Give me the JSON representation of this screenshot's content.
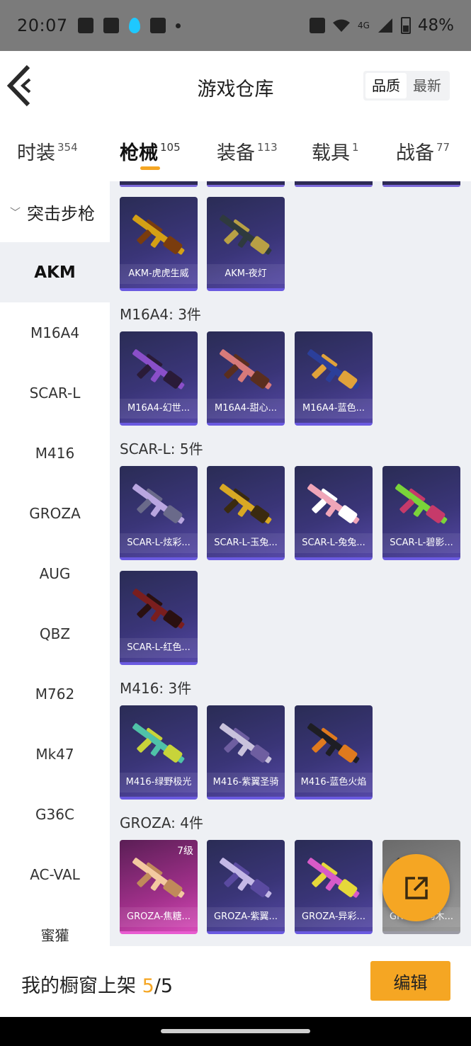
{
  "status_bar": {
    "time": "20:07",
    "network": "4G",
    "battery": "48%"
  },
  "header": {
    "title": "游戏仓库",
    "sort_options": [
      "品质",
      "最新"
    ],
    "sort_selected": "品质"
  },
  "tabs": [
    {
      "label": "时装",
      "count": "354"
    },
    {
      "label": "枪械",
      "count": "105",
      "active": true
    },
    {
      "label": "装备",
      "count": "113"
    },
    {
      "label": "载具",
      "count": "1"
    },
    {
      "label": "战备",
      "count": "77"
    }
  ],
  "sidebar": {
    "category": "突击步枪",
    "items": [
      "AKM",
      "M16A4",
      "SCAR-L",
      "M416",
      "GROZA",
      "AUG",
      "QBZ",
      "M762",
      "Mk47",
      "G36C",
      "AC-VAL",
      "蜜獾"
    ],
    "active": "AKM"
  },
  "sections": [
    {
      "title": "",
      "items": [
        {
          "name": "AKM-虎虎生威",
          "skin": [
            "#d4a015",
            "#7a3c0e"
          ]
        },
        {
          "name": "AKM-夜灯",
          "skin": [
            "#2f3a3e",
            "#b8a045"
          ]
        }
      ]
    },
    {
      "title": "M16A4: 3件",
      "items": [
        {
          "name": "M16A4-幻世...",
          "skin": [
            "#8a4fc9",
            "#2a1b38"
          ]
        },
        {
          "name": "M16A4-甜心...",
          "skin": [
            "#d77a7a",
            "#5a2e1e"
          ]
        },
        {
          "name": "M16A4-蓝色...",
          "skin": [
            "#2b3f9a",
            "#e0a23a"
          ]
        }
      ]
    },
    {
      "title": "SCAR-L: 5件",
      "items": [
        {
          "name": "SCAR-L-炫彩...",
          "skin": [
            "#b9a6e0",
            "#6a6a8a"
          ]
        },
        {
          "name": "SCAR-L-玉兔...",
          "skin": [
            "#d8a824",
            "#3a2a10"
          ]
        },
        {
          "name": "SCAR-L-兔兔...",
          "skin": [
            "#f0a5b8",
            "#ffffff"
          ]
        },
        {
          "name": "SCAR-L-碧影...",
          "skin": [
            "#7ad43a",
            "#c63a6a"
          ]
        },
        {
          "name": "SCAR-L-红色...",
          "skin": [
            "#7a1e1e",
            "#2a1010"
          ]
        }
      ]
    },
    {
      "title": "M416: 3件",
      "items": [
        {
          "name": "M416-绿野极光",
          "skin": [
            "#4fc2a8",
            "#c8d43a"
          ]
        },
        {
          "name": "M416-紫翼圣骑",
          "skin": [
            "#c9c2dc",
            "#6e5ea0"
          ]
        },
        {
          "name": "M416-蓝色火焰",
          "skin": [
            "#1e1e24",
            "#e07a1e"
          ]
        }
      ]
    },
    {
      "title": "GROZA: 4件",
      "items": [
        {
          "name": "GROZA-焦糖...",
          "skin": [
            "#f3c9a0",
            "#c08a5a"
          ],
          "tier": "7级",
          "variant": "pink"
        },
        {
          "name": "GROZA-紫翼...",
          "skin": [
            "#c4b8e6",
            "#5a4aa0"
          ]
        },
        {
          "name": "GROZA-异彩...",
          "skin": [
            "#d85ac8",
            "#e6d83a"
          ]
        },
        {
          "name": "GROZA-乌木...",
          "skin": [
            "#3a3a3a",
            "#7a7a7a"
          ],
          "variant": "gray"
        }
      ]
    }
  ],
  "footer": {
    "shelf_label": "我的橱窗上架",
    "shelf_current": "5",
    "shelf_separator": "/",
    "shelf_max": "5",
    "edit_label": "编辑"
  },
  "colors": {
    "accent": "#f5a623",
    "card_bg": "#3a3578",
    "content_bg": "#eef0f4"
  }
}
